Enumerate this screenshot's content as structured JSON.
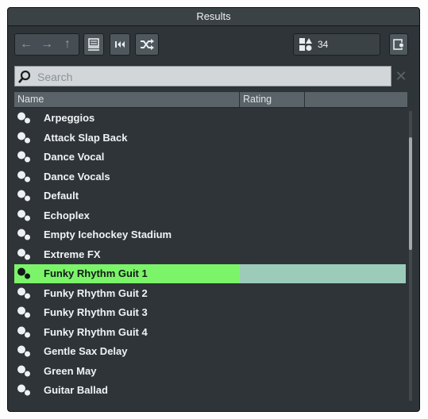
{
  "window": {
    "title": "Results"
  },
  "toolbar": {
    "back_icon": "arrow-left-icon",
    "forward_icon": "arrow-right-icon",
    "up_icon": "arrow-up-icon",
    "folder_icon": "folder-view-icon",
    "rewind_icon": "skip-to-start-icon",
    "shuffle_icon": "shuffle-icon",
    "result_count": "34",
    "settings_icon": "settings-icon"
  },
  "search": {
    "placeholder": "Search",
    "value": "",
    "clear_icon": "close-icon"
  },
  "columns": {
    "name": "Name",
    "rating": "Rating",
    "extra": ""
  },
  "results": [
    {
      "label": "Arpeggios"
    },
    {
      "label": "Attack Slap Back"
    },
    {
      "label": "Dance Vocal"
    },
    {
      "label": "Dance Vocals"
    },
    {
      "label": "Default"
    },
    {
      "label": "Echoplex"
    },
    {
      "label": "Empty Icehockey Stadium"
    },
    {
      "label": "Extreme FX"
    },
    {
      "label": "Funky Rhythm Guit 1",
      "selected": true
    },
    {
      "label": "Funky Rhythm Guit 2"
    },
    {
      "label": "Funky Rhythm Guit 3"
    },
    {
      "label": "Funky Rhythm Guit 4"
    },
    {
      "label": "Gentle Sax Delay"
    },
    {
      "label": "Green May"
    },
    {
      "label": "Guitar Ballad"
    }
  ],
  "colors": {
    "selected_name": "#7cf46a",
    "selected_rating": "#9ccbba",
    "panel_bg": "#2e3438"
  }
}
